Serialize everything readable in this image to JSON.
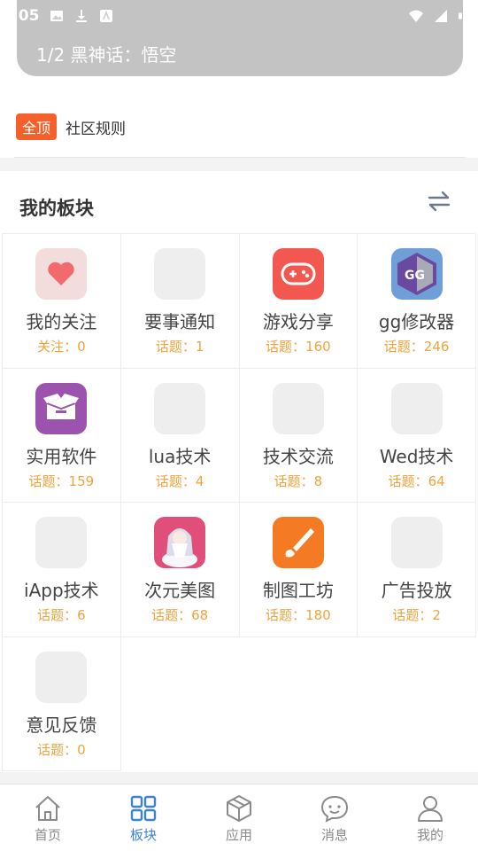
{
  "status_bar": {
    "time": ":05",
    "icons": [
      "image-icon",
      "download-icon",
      "app-icon",
      "wifi-icon",
      "signal-icon",
      "battery-icon"
    ]
  },
  "banner": {
    "text": "1/2 黑神话：悟空"
  },
  "notice": {
    "badge": "全顶",
    "text": "社区规则"
  },
  "board": {
    "title": "我的板块",
    "cells": [
      {
        "name": "我的关注",
        "stat": "关注：0",
        "icon": "heart-icon"
      },
      {
        "name": "要事通知",
        "stat": "话题：1",
        "icon": "placeholder-icon"
      },
      {
        "name": "游戏分享",
        "stat": "话题：160",
        "icon": "gamepad-icon"
      },
      {
        "name": "gg修改器",
        "stat": "话题：246",
        "icon": "gg-logo-icon"
      },
      {
        "name": "实用软件",
        "stat": "话题：159",
        "icon": "box-icon"
      },
      {
        "name": "lua技术",
        "stat": "话题：4",
        "icon": "placeholder-icon"
      },
      {
        "name": "技术交流",
        "stat": "话题：8",
        "icon": "placeholder-icon"
      },
      {
        "name": "Wed技术",
        "stat": "话题：64",
        "icon": "placeholder-icon"
      },
      {
        "name": "iApp技术",
        "stat": "话题：6",
        "icon": "placeholder-icon"
      },
      {
        "name": "次元美图",
        "stat": "话题：68",
        "icon": "anime-girl-icon"
      },
      {
        "name": "制图工坊",
        "stat": "话题：180",
        "icon": "brush-icon"
      },
      {
        "name": "广告投放",
        "stat": "话题：2",
        "icon": "placeholder-icon"
      },
      {
        "name": "意见反馈",
        "stat": "话题：0",
        "icon": "placeholder-icon"
      }
    ]
  },
  "nav": {
    "home": "首页",
    "boards": "板块",
    "apps": "应用",
    "messages": "消息",
    "mine": "我的",
    "active": "boards",
    "active_color": "#3a84d8",
    "inactive_color": "#8a8a8a"
  },
  "colors": {
    "badge": "#f5602b",
    "stat": "#f2a23c",
    "banner": "#c3c3c3"
  }
}
